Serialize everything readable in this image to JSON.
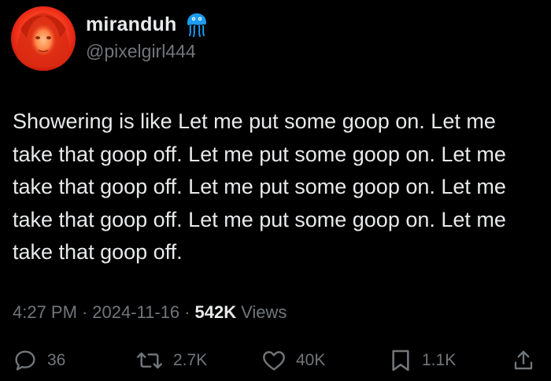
{
  "author": {
    "display_name": "miranduh",
    "handle": "@pixelgirl444",
    "badge_icon": "jellyfish-icon",
    "badge_color": "#1d9bf0"
  },
  "tweet": {
    "text": "Showering is like Let me put some goop on. Let me take that goop off. Let me put some goop on. Let me take that goop off. Let me put some goop on. Let me take that goop off. Let me put some goop on. Let me take that goop off."
  },
  "meta": {
    "time": "4:27 PM",
    "separator": "·",
    "date": "2024-11-16",
    "views_count": "542K",
    "views_label": "Views"
  },
  "actions": {
    "reply_count": "36",
    "retweet_count": "2.7K",
    "like_count": "40K",
    "bookmark_count": "1.1K"
  },
  "colors": {
    "background": "#000000",
    "primary_text": "#e7e9ea",
    "secondary_text": "#71767b",
    "accent": "#1d9bf0"
  }
}
